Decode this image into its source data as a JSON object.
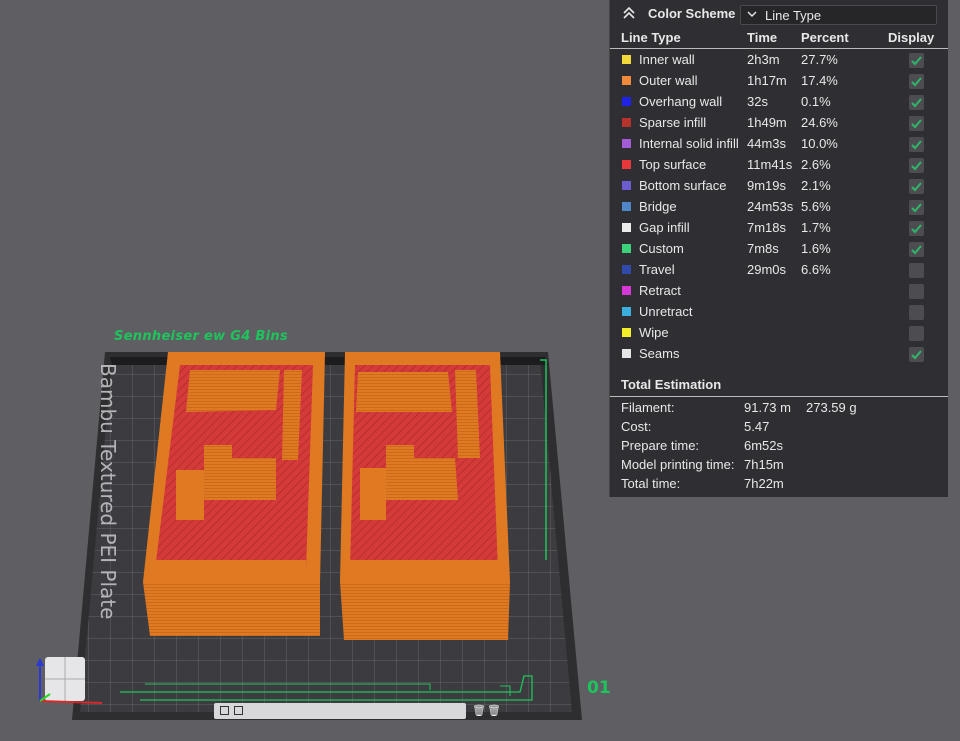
{
  "viewport": {
    "plate_name": "Sennheiser ew G4 Bins",
    "plate_label": "Bambu Textured PEI Plate",
    "plate_number": "01",
    "bin_colors": {
      "wall": "#e07a22",
      "infill": "#d43a3a",
      "seam": "#f0d040"
    },
    "toolbar_icons": [
      "grid-icon",
      "arrange-icon",
      "delete-icon",
      "delete-all-icon"
    ]
  },
  "legend": {
    "scheme_title": "Color Scheme",
    "scheme_value": "Line Type",
    "columns": {
      "type": "Line Type",
      "time": "Time",
      "percent": "Percent",
      "display": "Display"
    },
    "items": [
      {
        "name": "Inner wall",
        "time": "2h3m",
        "percent": "27.7%",
        "color": "#f3d83a",
        "checked": true
      },
      {
        "name": "Outer wall",
        "time": "1h17m",
        "percent": "17.4%",
        "color": "#f08a3a",
        "checked": true
      },
      {
        "name": "Overhang wall",
        "time": "32s",
        "percent": "0.1%",
        "color": "#1f23e6",
        "checked": true
      },
      {
        "name": "Sparse infill",
        "time": "1h49m",
        "percent": "24.6%",
        "color": "#b5332d",
        "checked": true
      },
      {
        "name": "Internal solid infill",
        "time": "44m3s",
        "percent": "10.0%",
        "color": "#a45bd6",
        "checked": true
      },
      {
        "name": "Top surface",
        "time": "11m41s",
        "percent": "2.6%",
        "color": "#e8383c",
        "checked": true
      },
      {
        "name": "Bottom surface",
        "time": "9m19s",
        "percent": "2.1%",
        "color": "#6b5dd0",
        "checked": true
      },
      {
        "name": "Bridge",
        "time": "24m53s",
        "percent": "5.6%",
        "color": "#4f86c8",
        "checked": true
      },
      {
        "name": "Gap infill",
        "time": "7m18s",
        "percent": "1.7%",
        "color": "#ebebeb",
        "checked": true
      },
      {
        "name": "Custom",
        "time": "7m8s",
        "percent": "1.6%",
        "color": "#3dd07a",
        "checked": true
      },
      {
        "name": "Travel",
        "time": "29m0s",
        "percent": "6.6%",
        "color": "#2f4aa8",
        "checked": false
      },
      {
        "name": "Retract",
        "time": "",
        "percent": "",
        "color": "#d63ad6",
        "checked": false
      },
      {
        "name": "Unretract",
        "time": "",
        "percent": "",
        "color": "#3aaedc",
        "checked": false
      },
      {
        "name": "Wipe",
        "time": "",
        "percent": "",
        "color": "#f2ee2a",
        "checked": false
      },
      {
        "name": "Seams",
        "time": "",
        "percent": "",
        "color": "#e6e6e6",
        "checked": true
      }
    ],
    "total_title": "Total Estimation",
    "estimates": [
      {
        "label": "Filament:",
        "value": "91.73 m",
        "value2": "273.59 g"
      },
      {
        "label": "Cost:",
        "value": "5.47",
        "value2": ""
      },
      {
        "label": "Prepare time:",
        "value": "6m52s",
        "value2": ""
      },
      {
        "label": "Model printing time:",
        "value": "7h15m",
        "value2": ""
      },
      {
        "label": "Total time:",
        "value": "7h22m",
        "value2": ""
      }
    ]
  }
}
